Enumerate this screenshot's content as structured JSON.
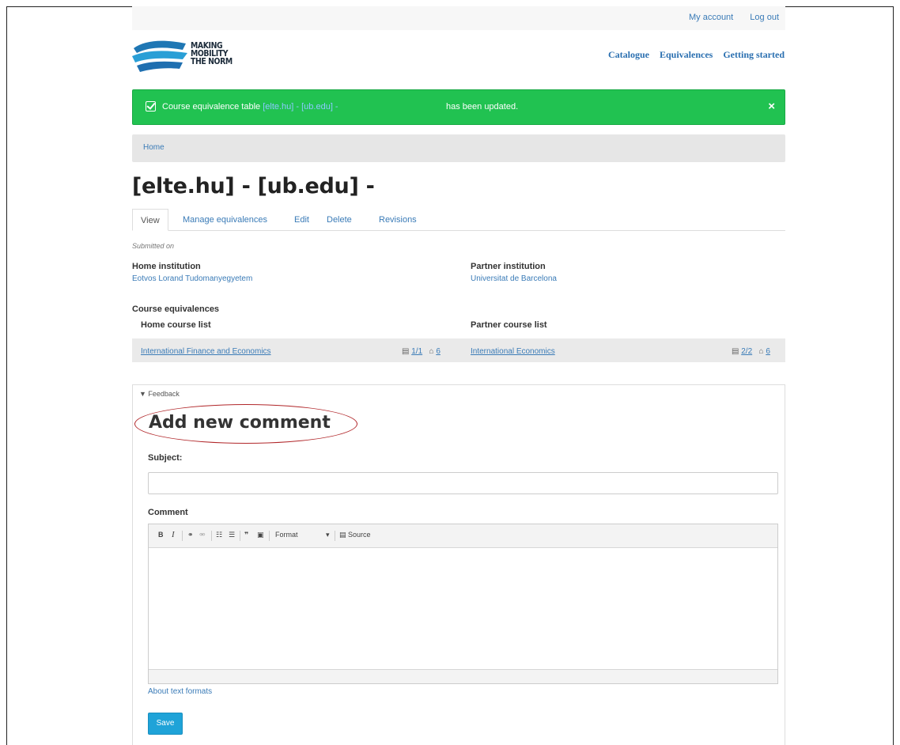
{
  "topbar": {
    "my_account": "My account",
    "log_out": "Log out"
  },
  "logo": {
    "line1": "MAKING",
    "line2": "MOBILITY",
    "line3": "THE NORM"
  },
  "nav": {
    "catalogue": "Catalogue",
    "equivalences": "Equivalences",
    "getting_started": "Getting started"
  },
  "alert": {
    "prefix": "Course equivalence table",
    "link": "[elte.hu] - [ub.edu] -",
    "suffix": "has been updated.",
    "close": "×",
    "color": "#21c251"
  },
  "breadcrumb": {
    "home": "Home"
  },
  "page_title": "[elte.hu] - [ub.edu] -",
  "tabs": [
    {
      "label": "View"
    },
    {
      "label": "Manage equivalences"
    },
    {
      "label": "Edit"
    },
    {
      "label": "Delete"
    },
    {
      "label": "Revisions"
    }
  ],
  "submitted": "Submitted on",
  "home_institution": {
    "label": "Home institution",
    "value": "Eotvos Lorand Tudomanyegyetem"
  },
  "partner_institution": {
    "label": "Partner institution",
    "value": "Universitat de Barcelona"
  },
  "course_equivalences": {
    "label": "Course equivalences",
    "home_header": "Home course list",
    "partner_header": "Partner course list",
    "home_course": {
      "name": "International Finance and Economics",
      "count": "1/1",
      "credits": "6"
    },
    "partner_course": {
      "name": "International Economics",
      "count": "2/2",
      "credits": "6"
    }
  },
  "feedback": {
    "summary": "▼ Feedback",
    "heading": "Add new comment",
    "subject_label": "Subject:",
    "subject_value": "",
    "comment_label": "Comment",
    "toolbar": {
      "bold": "B",
      "italic": "I",
      "link": "⚭",
      "unlink": "⚮",
      "bullets": "☷",
      "numbers": "☰",
      "quote": "❞",
      "image": "▣",
      "format": "Format",
      "format_caret": "▾",
      "source": "Source"
    },
    "about_formats": "About text formats",
    "save": "Save"
  }
}
